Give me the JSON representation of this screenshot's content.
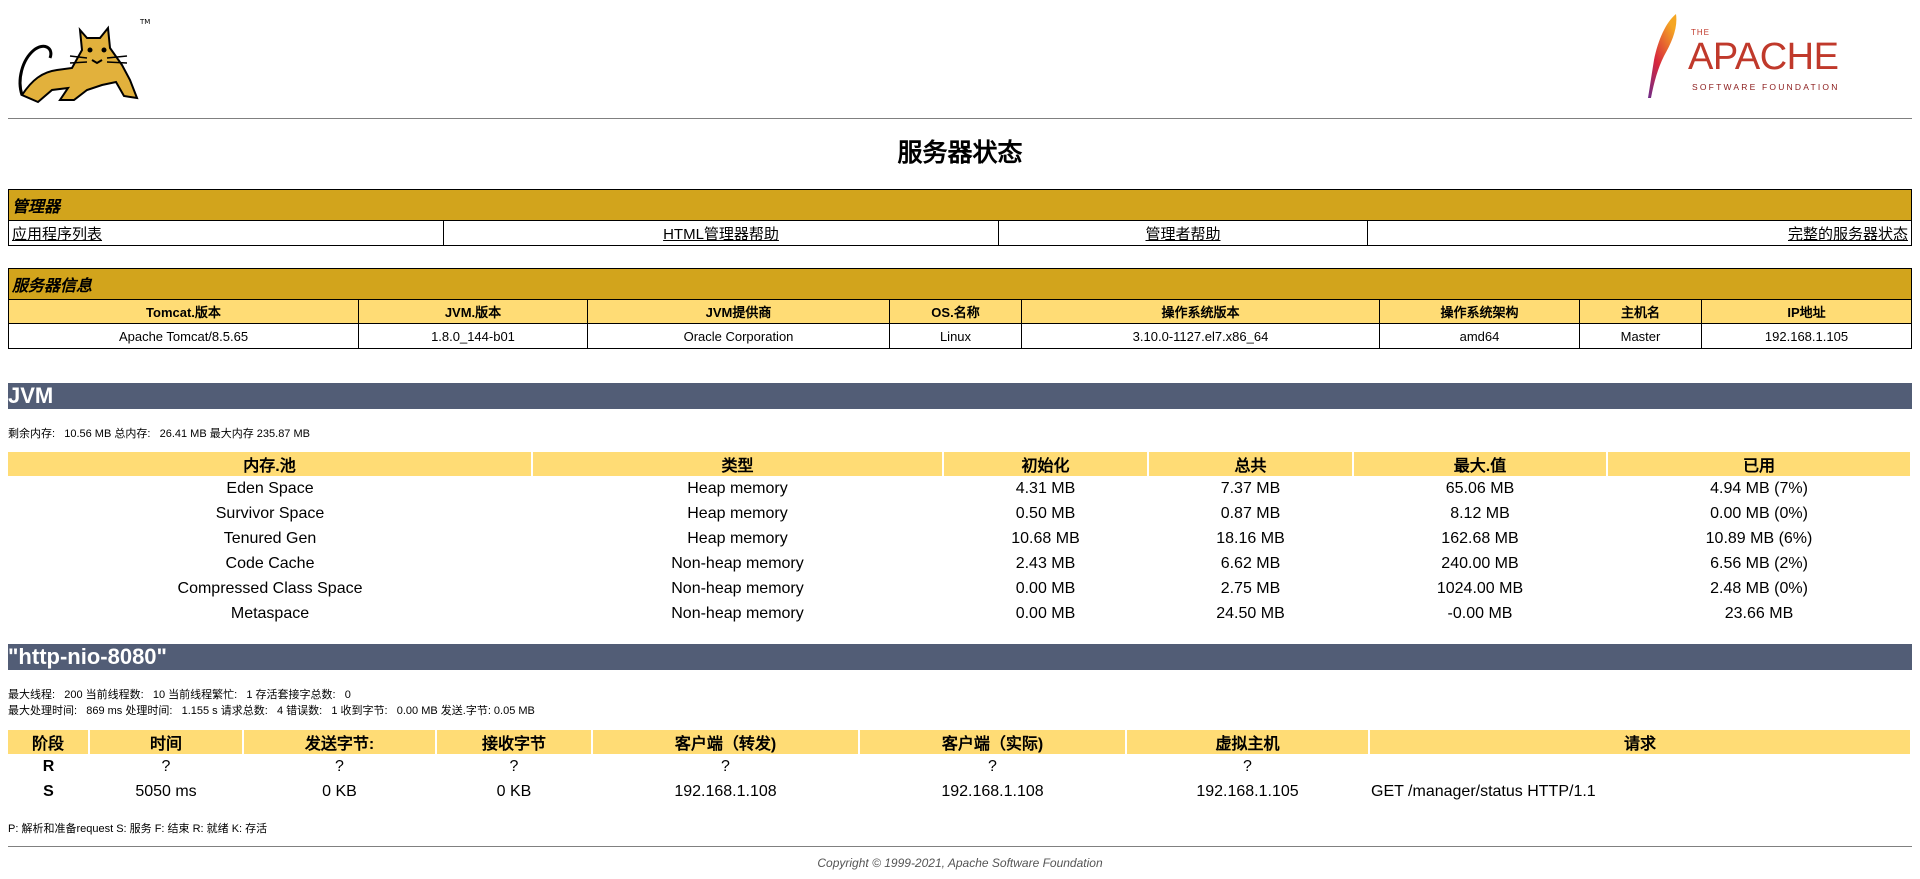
{
  "header": {
    "tomcat_logo": "tomcat-logo",
    "apache": {
      "the": "THE",
      "word": "APACHE",
      "sub": "SOFTWARE FOUNDATION",
      "tm": "®"
    }
  },
  "title": "服务器状态",
  "manager": {
    "title": "管理器",
    "links": [
      "应用程序列表",
      "HTML管理器帮助",
      "管理者帮助",
      "完整的服务器状态"
    ]
  },
  "server_info": {
    "title": "服务器信息",
    "headers": [
      "Tomcat.版本",
      "JVM.版本",
      "JVM提供商",
      "OS.名称",
      "操作系统版本",
      "操作系统架构",
      "主机名",
      "IP地址"
    ],
    "values": [
      "Apache Tomcat/8.5.65",
      "1.8.0_144-b01",
      "Oracle Corporation",
      "Linux",
      "3.10.0-1127.el7.x86_64",
      "amd64",
      "Master",
      "192.168.1.105"
    ]
  },
  "jvm": {
    "band": "JVM",
    "summary": "剩余内存:   10.56 MB 总内存:   26.41 MB 最大内存 235.87 MB",
    "headers": [
      "内存.池",
      "类型",
      "初始化",
      "总共",
      "最大.值",
      "已用"
    ],
    "rows": [
      [
        "Eden Space",
        "Heap memory",
        "4.31 MB",
        "7.37 MB",
        "65.06 MB",
        "4.94 MB (7%)"
      ],
      [
        "Survivor Space",
        "Heap memory",
        "0.50 MB",
        "0.87 MB",
        "8.12 MB",
        "0.00 MB (0%)"
      ],
      [
        "Tenured Gen",
        "Heap memory",
        "10.68 MB",
        "18.16 MB",
        "162.68 MB",
        "10.89 MB (6%)"
      ],
      [
        "Code Cache",
        "Non-heap memory",
        "2.43 MB",
        "6.62 MB",
        "240.00 MB",
        "6.56 MB (2%)"
      ],
      [
        "Compressed Class Space",
        "Non-heap memory",
        "0.00 MB",
        "2.75 MB",
        "1024.00 MB",
        "2.48 MB (0%)"
      ],
      [
        "Metaspace",
        "Non-heap memory",
        "0.00 MB",
        "24.50 MB",
        "-0.00 MB",
        "23.66 MB"
      ]
    ]
  },
  "connector": {
    "band": "\"http-nio-8080\"",
    "line1": "最大线程:   200 当前线程数:   10 当前线程繁忙:   1 存活套接字总数:   0",
    "line2": "最大处理时间:   869 ms 处理时间:   1.155 s 请求总数:   4 错误数:   1 收到字节:   0.00 MB 发送.字节: 0.05 MB",
    "headers": [
      "阶段",
      "时间",
      "发送字节:",
      "接收字节",
      "客户端（转发)",
      "客户端（实际)",
      "虚拟主机",
      "请求"
    ],
    "rows": [
      [
        "R",
        "?",
        "?",
        "?",
        "?",
        "?",
        "?",
        ""
      ],
      [
        "S",
        "5050 ms",
        "0 KB",
        "0 KB",
        "192.168.1.108",
        "192.168.1.108",
        "192.168.1.105",
        "GET /manager/status HTTP/1.1"
      ]
    ],
    "legend": "P: 解析和准备request S: 服务 F: 结束 R: 就绪 K: 存活"
  },
  "footer": {
    "copyright": "Copyright © 1999-2021, Apache Software Foundation"
  },
  "colors": {
    "section": "#d2a41c",
    "header_row": "#ffdc75",
    "band": "#525d76"
  }
}
